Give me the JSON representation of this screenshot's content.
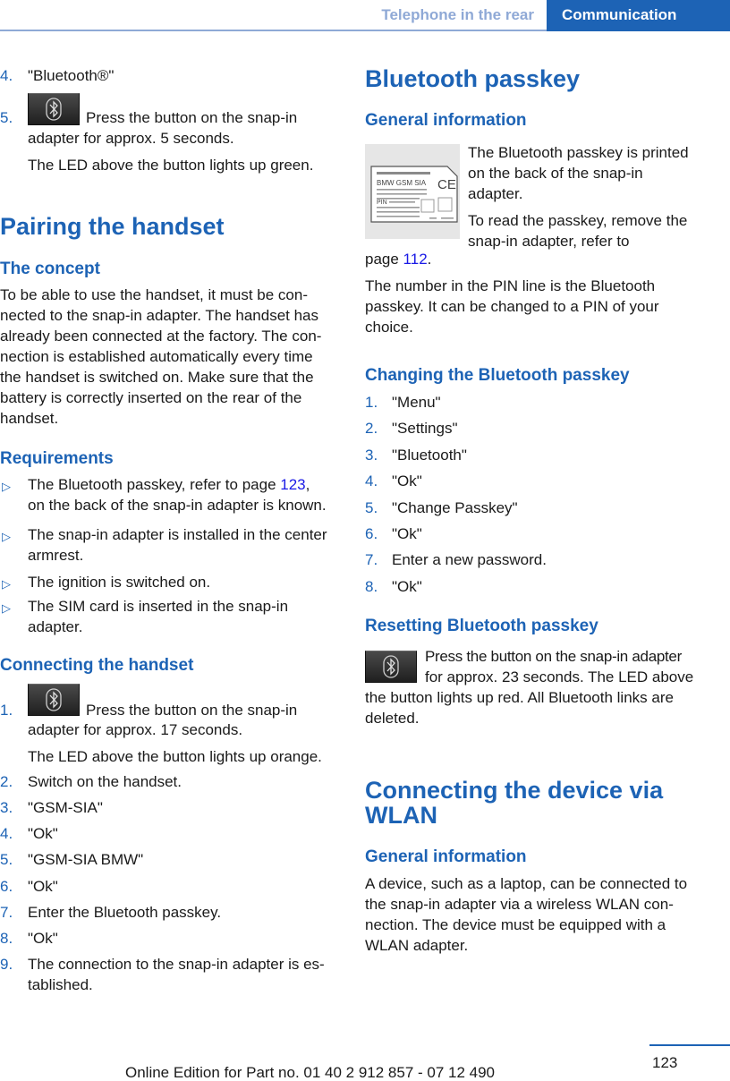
{
  "header": {
    "section_tab": "Telephone in the rear",
    "chapter_tab": "Communication"
  },
  "left": {
    "cont_steps": [
      {
        "num": "4.",
        "text": "\"Bluetooth®\""
      },
      {
        "num": "5.",
        "text_after_icon": "Press the button on the snap-in",
        "text_line2": "adapter for approx. 5 seconds.",
        "note": "The LED above the button lights up green."
      }
    ],
    "pairing_title": "Pairing the handset",
    "concept_title": "The concept",
    "concept_lines": [
      "To be able to use the handset, it must be con-",
      "nected to the snap-in adapter. The handset has",
      "already been connected at the factory. The con-",
      "nection is established automatically every time",
      "the handset is switched on. Make sure that the",
      "battery is correctly inserted on the rear of the",
      "handset."
    ],
    "requirements_title": "Requirements",
    "requirements": [
      {
        "line1_pre": "The Bluetooth passkey, refer to page ",
        "link": "123",
        "line1_post": ",",
        "line2": "on the back of the snap-in adapter is known."
      },
      {
        "line1": "The snap-in adapter is installed in the center",
        "line2": "armrest."
      },
      {
        "line1": "The ignition is switched on."
      },
      {
        "line1": "The SIM card is inserted in the snap-in",
        "line2": "adapter."
      }
    ],
    "connecting_title": "Connecting the handset",
    "connecting_steps": [
      {
        "num": "1.",
        "text_after_icon": "Press the button on the snap-in",
        "text_line2": "adapter for approx. 17 seconds.",
        "note": "The LED above the button lights up orange."
      },
      {
        "num": "2.",
        "text": "Switch on the handset."
      },
      {
        "num": "3.",
        "text": "\"GSM-SIA\""
      },
      {
        "num": "4.",
        "text": "\"Ok\""
      },
      {
        "num": "5.",
        "text": "\"GSM-SIA BMW\""
      },
      {
        "num": "6.",
        "text": "\"Ok\""
      },
      {
        "num": "7.",
        "text": "Enter the Bluetooth passkey."
      },
      {
        "num": "8.",
        "text": "\"Ok\""
      },
      {
        "num": "9.",
        "text": "The connection to the snap-in adapter is es-",
        "text_line2": "tablished."
      }
    ]
  },
  "right": {
    "passkey_title": "Bluetooth passkey",
    "general_title": "General information",
    "label_image": {
      "brand_text": "BMW GSM SIA",
      "pin_text": "PIN",
      "ce_text": "CE"
    },
    "general_lines": [
      "The Bluetooth passkey is printed",
      "on the back of the snap-in",
      "adapter.",
      "To read the passkey, remove the",
      "snap-in adapter, refer to"
    ],
    "general_ref_pre": "page ",
    "general_ref_link": "112",
    "general_ref_post": ".",
    "pin_lines": [
      "The number in the PIN line is the Bluetooth",
      "passkey. It can be changed to a PIN of your",
      "choice."
    ],
    "changing_title": "Changing the Bluetooth passkey",
    "changing_steps": [
      {
        "num": "1.",
        "text": "\"Menu\""
      },
      {
        "num": "2.",
        "text": "\"Settings\""
      },
      {
        "num": "3.",
        "text": "\"Bluetooth\""
      },
      {
        "num": "4.",
        "text": "\"Ok\""
      },
      {
        "num": "5.",
        "text": "\"Change Passkey\""
      },
      {
        "num": "6.",
        "text": "\"Ok\""
      },
      {
        "num": "7.",
        "text": "Enter a new password."
      },
      {
        "num": "8.",
        "text": "\"Ok\""
      }
    ],
    "resetting_title": "Resetting Bluetooth passkey",
    "resetting_lines": [
      "Press the button on the snap-in adapter",
      "for approx. 23 seconds. The LED above",
      "the button lights up red. All Bluetooth links are",
      "deleted."
    ],
    "wlan_title_line1": "Connecting the device via",
    "wlan_title_line2": "WLAN",
    "wlan_general_title": "General information",
    "wlan_lines": [
      "A device, such as a laptop, can be connected to",
      "the snap-in adapter via a wireless WLAN con-",
      "nection. The device must be equipped with a",
      "WLAN adapter."
    ]
  },
  "footer": {
    "page_number": "123",
    "edition_text": "Online Edition for Part no. 01 40 2 912 857 - 07 12 490"
  }
}
